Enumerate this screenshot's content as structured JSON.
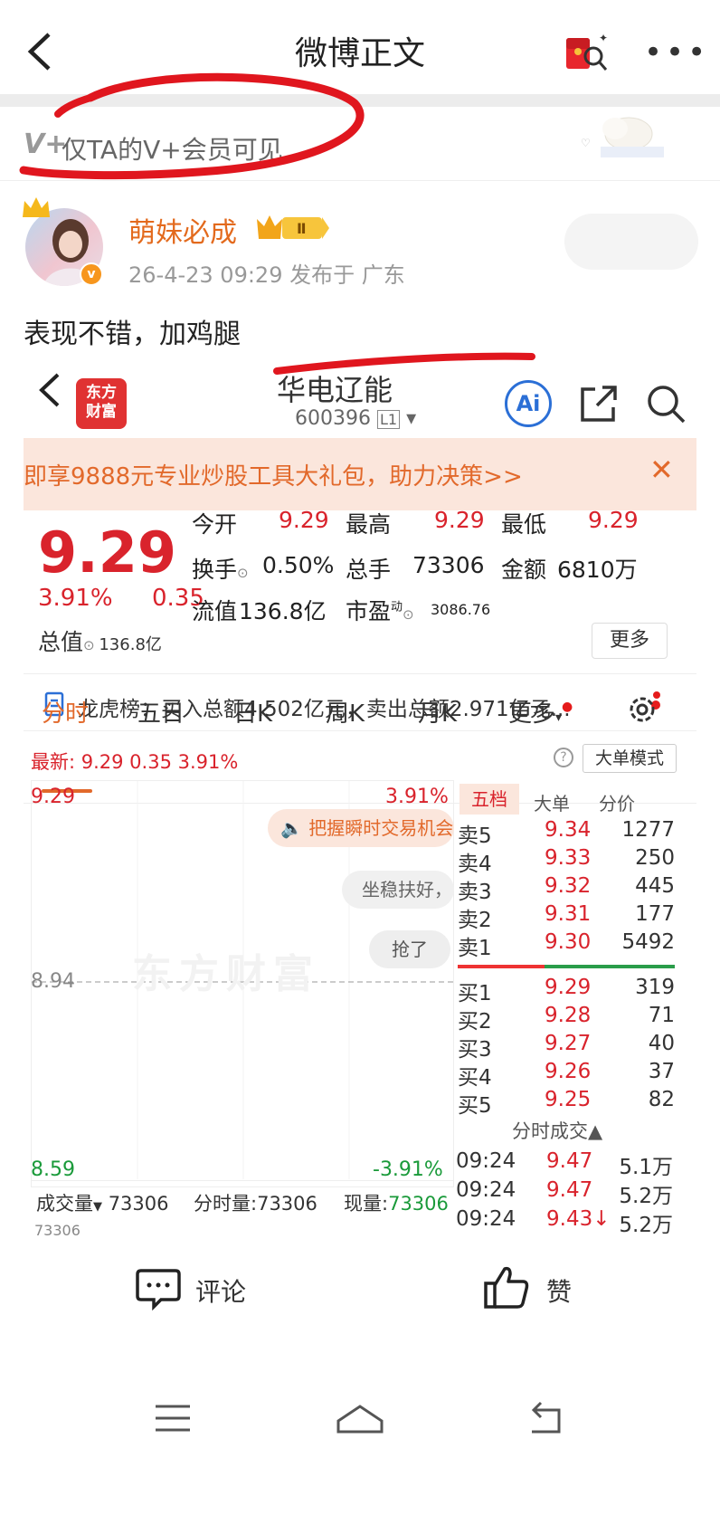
{
  "header": {
    "title": "微博正文",
    "more_icon": "more-dots-icon",
    "redpacket_icon": "red-packet-icon"
  },
  "vip_notice": {
    "icon_text": "V+",
    "text": "仅TA的V+会员可见"
  },
  "author": {
    "name": "萌妹必成",
    "level": "Ⅱ",
    "time_loc": "26-4-23 09:29 发布于 广东",
    "verified_badge": "v"
  },
  "post": {
    "text": "表现不错，加鸡腿"
  },
  "embedded": {
    "app_logo": "东方\n财富",
    "stock_name": "华电辽能",
    "stock_code": "600396",
    "code_tag": "L1",
    "ai_label": "Ai",
    "banner": "即享9888元专业炒股工具大礼包，助力决策>>",
    "banner_close": "✕",
    "price": "9.29",
    "pct": "3.91%",
    "chg": "0.35",
    "quotes": {
      "open_label": "今开",
      "open": "9.29",
      "high_label": "最高",
      "high": "9.29",
      "low_label": "最低",
      "low": "9.29",
      "turn_label": "换手",
      "turn": "0.50%",
      "vol_label": "总手",
      "vol": "73306",
      "amt_label": "金额",
      "amt": "6810万",
      "mcap_label": "总值",
      "mcap": "136.8亿",
      "float_label": "流值",
      "float": "136.8亿",
      "pe_label": "市盈",
      "pe_sup": "动",
      "pe": "3086.76",
      "more": "更多"
    },
    "lhb": "龙虎榜：买入总额4.502亿元，卖出总额2.971亿元...",
    "tabs": [
      "分时",
      "五日",
      "日K",
      "周K",
      "月K",
      "更多"
    ],
    "newest": "最新: 9.29  0.35  3.91%",
    "help": "?",
    "big_mode": "大单模式",
    "chart": {
      "high": "9.29",
      "high_pct": "3.91%",
      "mid": "8.94",
      "low": "8.59",
      "low_pct": "-3.91%"
    },
    "tips": {
      "tip1": "把握瞬时交易机会",
      "tip2": "坐稳扶好，",
      "tip3": "抢了"
    },
    "watermark": "东方财富",
    "volume": {
      "label": "成交量",
      "total": "73306",
      "fs_label": "分时量:",
      "fs": "73306",
      "now_label": "现量:",
      "now": "73306",
      "axis": "73306"
    },
    "orderbook": {
      "head": [
        "五档",
        "大单",
        "分价"
      ],
      "sells": [
        {
          "l": "卖5",
          "p": "9.34",
          "v": "1277"
        },
        {
          "l": "卖4",
          "p": "9.33",
          "v": "250"
        },
        {
          "l": "卖3",
          "p": "9.32",
          "v": "445"
        },
        {
          "l": "卖2",
          "p": "9.31",
          "v": "177"
        },
        {
          "l": "卖1",
          "p": "9.30",
          "v": "5492"
        }
      ],
      "buys": [
        {
          "l": "买1",
          "p": "9.29",
          "v": "319"
        },
        {
          "l": "买2",
          "p": "9.28",
          "v": "71"
        },
        {
          "l": "买3",
          "p": "9.27",
          "v": "40"
        },
        {
          "l": "买4",
          "p": "9.26",
          "v": "37"
        },
        {
          "l": "买5",
          "p": "9.25",
          "v": "82"
        }
      ]
    },
    "trades_title": "分时成交▲",
    "trades": [
      {
        "t": "09:24",
        "p": "9.47",
        "v": "5.1万"
      },
      {
        "t": "09:24",
        "p": "9.47",
        "v": "5.2万"
      },
      {
        "t": "09:24",
        "p": "9.43↓",
        "v": "5.2万"
      }
    ]
  },
  "actions": {
    "comment": "评论",
    "like": "赞"
  },
  "colors": {
    "red": "#d9232c",
    "orange": "#e2692b",
    "green": "#1a9a3a",
    "annotation": "#e0161e"
  }
}
